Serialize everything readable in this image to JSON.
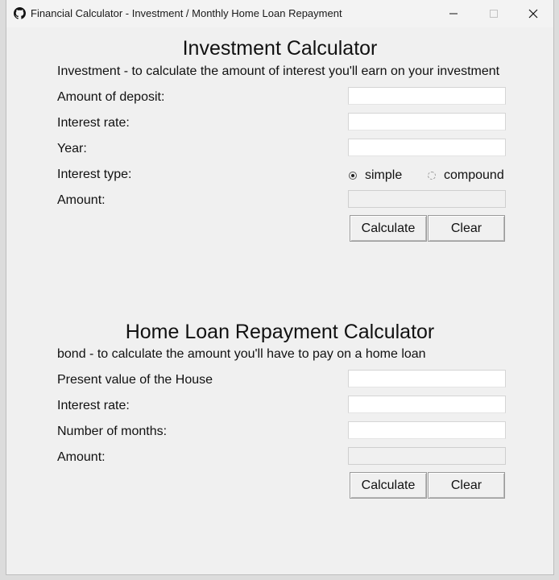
{
  "window": {
    "title": "Financial Calculator - Investment / Monthly Home Loan Repayment",
    "app_icon": "github-icon",
    "controls": [
      "minimize-icon",
      "maximize-icon",
      "close-icon"
    ]
  },
  "investment": {
    "heading": "Investment Calculator",
    "description": "Investment - to calculate the amount of interest you'll earn on your investment",
    "labels": {
      "deposit": "Amount of deposit:",
      "rate": "Interest rate:",
      "year": "Year:",
      "type": "Interest type:",
      "amount": "Amount:"
    },
    "values": {
      "deposit": "",
      "rate": "",
      "year": "",
      "amount": ""
    },
    "interest_type": {
      "simple": "simple",
      "compound": "compound",
      "selected": "simple"
    },
    "buttons": {
      "calculate": "Calculate",
      "clear": "Clear"
    }
  },
  "bond": {
    "heading": "Home Loan Repayment Calculator",
    "description": "bond - to calculate the amount you'll have to pay on a home loan",
    "labels": {
      "present_value": "Present value of the House",
      "rate": "Interest rate:",
      "months": "Number of months:",
      "amount": "Amount:"
    },
    "values": {
      "present_value": "",
      "rate": "",
      "months": "",
      "amount": ""
    },
    "buttons": {
      "calculate": "Calculate",
      "clear": "Clear"
    }
  }
}
